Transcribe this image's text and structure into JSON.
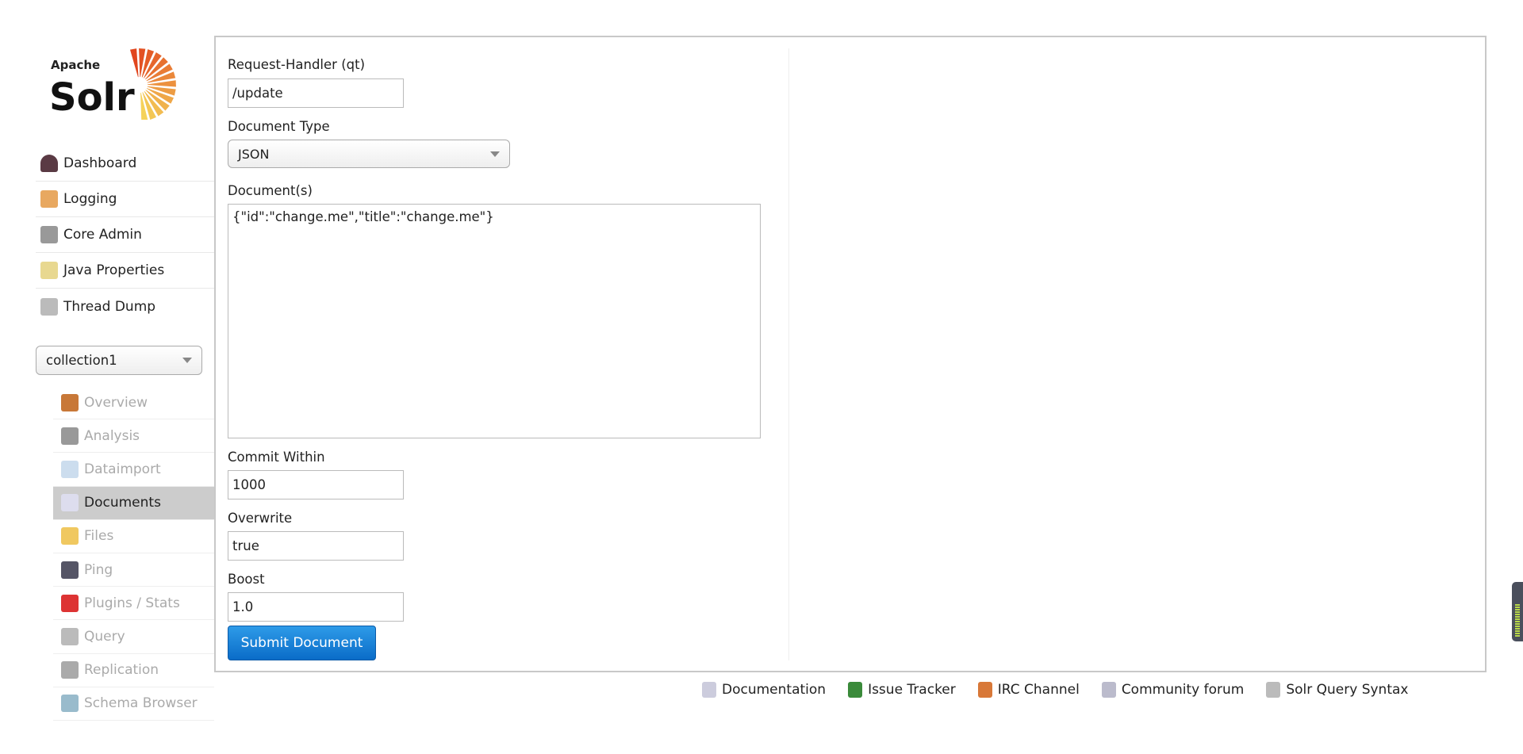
{
  "logo": {
    "small": "Apache",
    "big": "Solr"
  },
  "nav": [
    {
      "label": "Dashboard",
      "icon": "dashboard-icon"
    },
    {
      "label": "Logging",
      "icon": "logging-icon"
    },
    {
      "label": "Core Admin",
      "icon": "core-admin-icon"
    },
    {
      "label": "Java Properties",
      "icon": "java-properties-icon"
    },
    {
      "label": "Thread Dump",
      "icon": "thread-dump-icon"
    }
  ],
  "core_selector": {
    "value": "collection1"
  },
  "core_menu": [
    {
      "label": "Overview",
      "icon": "home-icon"
    },
    {
      "label": "Analysis",
      "icon": "funnel-icon"
    },
    {
      "label": "Dataimport",
      "icon": "dataimport-icon"
    },
    {
      "label": "Documents",
      "icon": "documents-icon",
      "active": true
    },
    {
      "label": "Files",
      "icon": "folder-icon"
    },
    {
      "label": "Ping",
      "icon": "ping-icon"
    },
    {
      "label": "Plugins / Stats",
      "icon": "plugins-icon"
    },
    {
      "label": "Query",
      "icon": "magnifier-icon"
    },
    {
      "label": "Replication",
      "icon": "replication-icon"
    },
    {
      "label": "Schema Browser",
      "icon": "book-icon"
    }
  ],
  "form": {
    "request_handler": {
      "label": "Request-Handler (qt)",
      "value": "/update"
    },
    "document_type": {
      "label": "Document Type",
      "value": "JSON"
    },
    "documents": {
      "label": "Document(s)",
      "value": "{\"id\":\"change.me\",\"title\":\"change.me\"}"
    },
    "commit_within": {
      "label": "Commit Within",
      "value": "1000"
    },
    "overwrite": {
      "label": "Overwrite",
      "value": "true"
    },
    "boost": {
      "label": "Boost",
      "value": "1.0"
    },
    "submit_label": "Submit Document"
  },
  "footer": [
    {
      "label": "Documentation",
      "icon": "document-icon"
    },
    {
      "label": "Issue Tracker",
      "icon": "bug-icon"
    },
    {
      "label": "IRC Channel",
      "icon": "users-icon"
    },
    {
      "label": "Community forum",
      "icon": "mail-icon"
    },
    {
      "label": "Solr Query Syntax",
      "icon": "syntax-icon"
    }
  ],
  "colors": {
    "accent": "#0a6cc8",
    "active_bg": "#cccccc",
    "logo_orange": "#e8551e"
  }
}
